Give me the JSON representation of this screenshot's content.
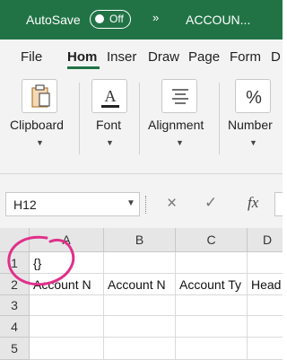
{
  "titlebar": {
    "autosave_label": "AutoSave",
    "toggle_state": "Off",
    "chevron": "»",
    "doc_title": "ACCOUN..."
  },
  "ribbon_tabs": [
    "File",
    "Hom",
    "Inser",
    "Draw",
    "Page",
    "Form",
    "D"
  ],
  "ribbon_groups": [
    {
      "label": "Clipboard",
      "icon": "clipboard-icon"
    },
    {
      "label": "Font",
      "icon": "font-color-icon"
    },
    {
      "label": "Alignment",
      "icon": "align-icon"
    },
    {
      "label": "Number",
      "icon": "percent-icon"
    }
  ],
  "formula_bar": {
    "name_box": "H12",
    "cancel": "×",
    "enter": "✓",
    "fx": "fx"
  },
  "sheet": {
    "columns": [
      "A",
      "B",
      "C",
      "D"
    ],
    "rows": [
      "1",
      "2",
      "3",
      "4",
      "5"
    ],
    "cells": {
      "a1": "{}",
      "a2": "Account N",
      "b2": "Account N",
      "c2": "Account Ty",
      "d2": "Head"
    }
  },
  "colors": {
    "brand": "#217346",
    "annotation": "#e0308a"
  }
}
